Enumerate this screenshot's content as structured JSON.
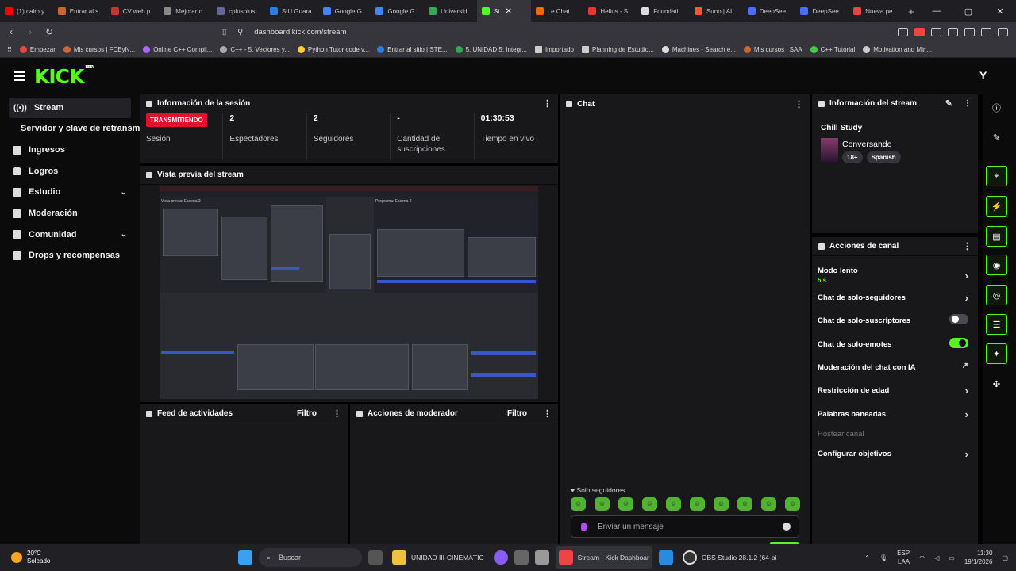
{
  "browser": {
    "tabs": [
      "(1) calm y",
      "Entrar al s",
      "CV web p",
      "Mejorar c",
      "cplusplus",
      "SIU Guara",
      "Google G",
      "Google G",
      "Universid",
      "St",
      "Le Chat",
      "Helius - S",
      "Foundati",
      "Suno | AI",
      "DeepSee",
      "DeepSee",
      "Nueva pe"
    ],
    "url": "dashboard.kick.com/stream",
    "bookmarks": [
      "Empezar",
      "Mis cursos | FCEyN...",
      "Online C++ Compil...",
      "C++ - 5. Vectores y...",
      "Python Tutor code v...",
      "Entrar al sitio | STE...",
      "5. UNIDAD 5: Integr...",
      "Importado",
      "Planning de Estudio...",
      "Machines - Search e...",
      "Mis cursos | SAA",
      "C++ Tutorial",
      "Motivation and Min..."
    ]
  },
  "header": {
    "logo": "KICK",
    "beta": "BETA"
  },
  "sidebar": {
    "items": [
      {
        "label": "Stream"
      },
      {
        "label": "Servidor y clave de retransmisión"
      },
      {
        "label": "Ingresos"
      },
      {
        "label": "Logros"
      },
      {
        "label": "Estudio"
      },
      {
        "label": "Moderación"
      },
      {
        "label": "Comunidad"
      },
      {
        "label": "Drops y recompensas"
      }
    ]
  },
  "session": {
    "title": "Información de la sesión",
    "status_badge": "TRANSMITIENDO",
    "stats": [
      {
        "value": "",
        "label": "Sesión"
      },
      {
        "value": "2",
        "label": "Espectadores"
      },
      {
        "value": "2",
        "label": "Seguidores"
      },
      {
        "value": "-",
        "label": "Cantidad de suscripciones"
      },
      {
        "value": "01:30:53",
        "label": "Tiempo en vivo"
      }
    ]
  },
  "preview": {
    "title": "Vista previa del stream",
    "obs_preview": "Vista previa: Escena 2",
    "obs_program": "Programa: Escena 2"
  },
  "activity": {
    "title": "Feed de actividades",
    "filter": "Filtro"
  },
  "modactions": {
    "title": "Acciones de moderador",
    "filter": "Filtro"
  },
  "chat": {
    "title": "Chat",
    "mode": "Solo seguidores",
    "placeholder": "Enviar un mensaje"
  },
  "stream_info": {
    "title": "Información del stream",
    "stream_title": "Chill Study",
    "category": "Conversando",
    "tags": [
      "18+",
      "Spanish"
    ]
  },
  "channel_actions": {
    "title": "Acciones de canal",
    "items": [
      {
        "label": "Modo lento",
        "sub": "5 s",
        "control": "arrow"
      },
      {
        "label": "Chat de solo-seguidores",
        "control": "arrow"
      },
      {
        "label": "Chat de solo-suscriptores",
        "control": "toggle-off"
      },
      {
        "label": "Chat de solo-emotes",
        "control": "toggle-on"
      },
      {
        "label": "Moderación del chat con IA",
        "control": "external"
      },
      {
        "label": "Restricción de edad",
        "control": "arrow"
      },
      {
        "label": "Palabras baneadas",
        "control": "arrow"
      },
      {
        "label": "Hostear canal",
        "control": "none"
      },
      {
        "label": "Configurar objetivos",
        "control": "arrow"
      }
    ]
  },
  "taskbar": {
    "weather_temp": "20°C",
    "weather_desc": "Soleado",
    "search": "Buscar",
    "apps": [
      "UNIDAD III-CINEMÁTIC",
      "Stream - Kick Dashboar",
      "OBS Studio 28.1.2 (64-bi"
    ],
    "lang1": "ESP",
    "lang2": "LAA",
    "time": "11:30",
    "date": "19/1/2026"
  },
  "colors": {
    "accent": "#53fc18",
    "live": "#e4112c",
    "panel": "#18181b",
    "bg": "#0b0b0c"
  }
}
